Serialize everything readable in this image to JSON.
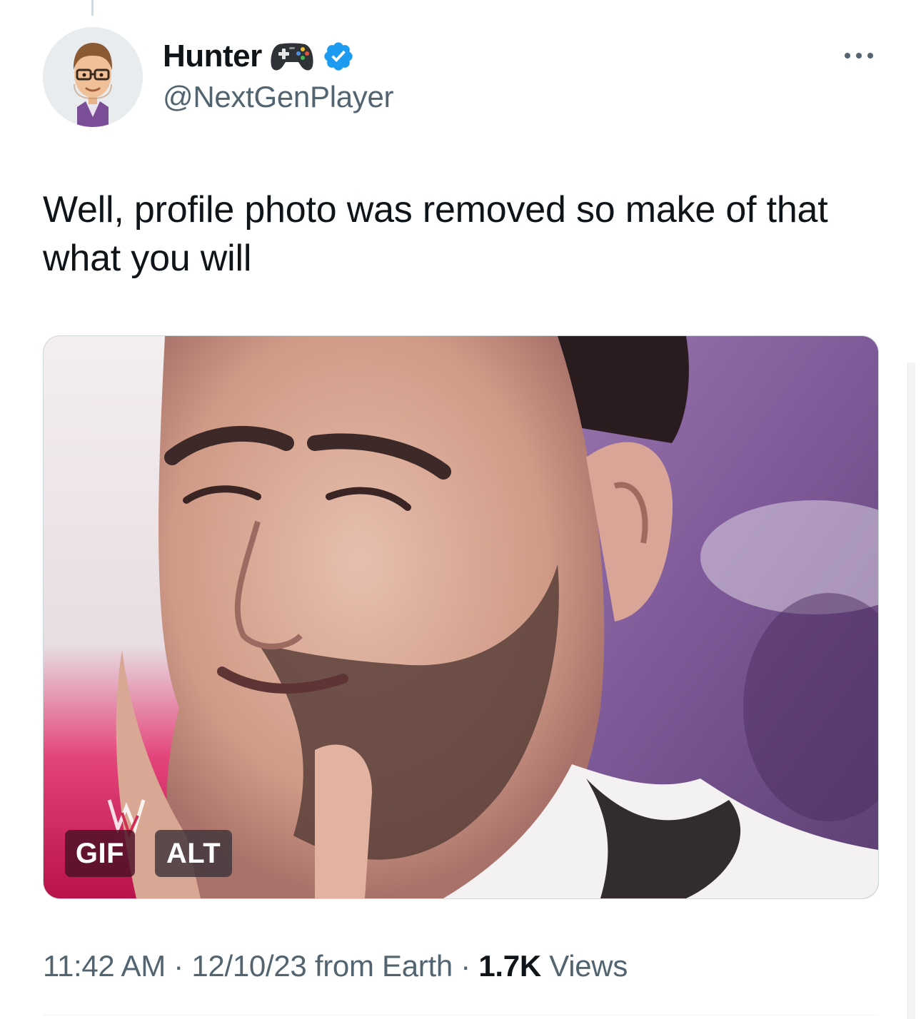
{
  "author": {
    "display_name": "Hunter",
    "handle": "@NextGenPlayer",
    "avatar_icon": "bitmoji-avatar",
    "name_emoji_icon": "video-game-controller-icon",
    "verified_icon": "verified-badge-icon",
    "verified_color": "#1d9bf0"
  },
  "tweet": {
    "text": "Well, profile photo was removed so make of that what you will"
  },
  "media": {
    "type_badge": "GIF",
    "alt_badge": "ALT",
    "watermark_icon": "wwe-logo-icon"
  },
  "meta": {
    "time": "11:42 AM",
    "sep1": " · ",
    "date": "12/10/23",
    "source": " from Earth",
    "sep2": " · ",
    "views_count": "1.7K",
    "views_label": " Views"
  },
  "colors": {
    "text_primary": "#0f1419",
    "text_secondary": "#536471",
    "accent": "#1d9bf0"
  }
}
